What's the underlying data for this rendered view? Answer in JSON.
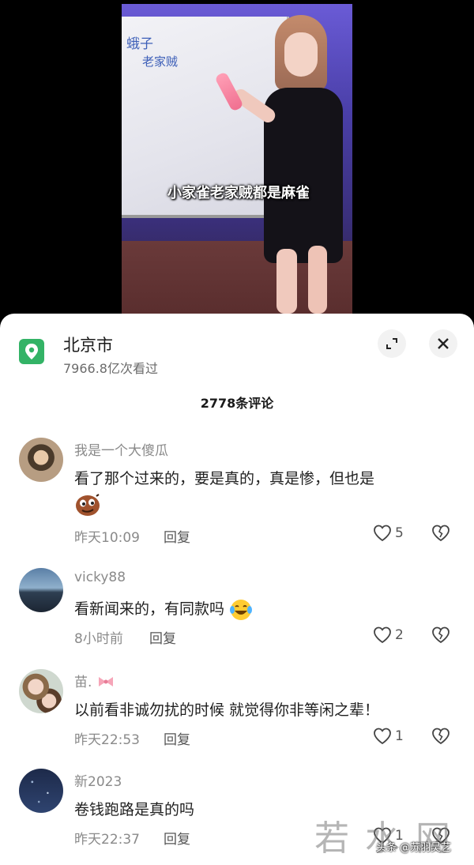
{
  "video": {
    "subtitle": "小家雀老家贼都是麻雀",
    "board_line1": "蛾子",
    "board_line2": "老家贼"
  },
  "location": {
    "title": "北京市",
    "views": "7966.8亿次看过",
    "icon": "location-pin-icon",
    "accent_color": "#33b366"
  },
  "header_actions": {
    "expand_icon": "expand-icon",
    "close_icon": "close-icon"
  },
  "comments_title": "2778条评论",
  "comments": [
    {
      "user": "我是一个大傻瓜",
      "text": "看了那个过来的，要是真的，真是惨，但也是",
      "emoji": "smirk-emoji",
      "time": "昨天10:09",
      "reply": "回复",
      "likes": "5"
    },
    {
      "user": "vicky88",
      "text": "看新闻来的，有同款吗",
      "emoji": "laugh-cry-emoji",
      "time": "8小时前",
      "reply": "回复",
      "likes": "2"
    },
    {
      "user": "苗.",
      "user_icon": "bow-icon",
      "text": "以前看非诚勿扰的时候 就觉得你非等闲之辈！",
      "time": "昨天22:53",
      "reply": "回复",
      "likes": "1"
    },
    {
      "user": "新2023",
      "text": "卷钱跑路是真的吗",
      "time": "昨天22:37",
      "reply": "回复",
      "likes": "1"
    }
  ],
  "watermark": {
    "large": "若水网",
    "small": "头条 @苏羽昊艺"
  }
}
